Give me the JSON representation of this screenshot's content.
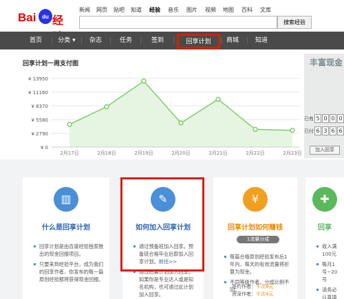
{
  "header": {
    "logo_text": "Bai",
    "logo_paw": "du",
    "logo_suffix": "经验",
    "nav_links": [
      "新闻",
      "网页",
      "贴吧",
      "知道",
      "经验",
      "音乐",
      "图片",
      "视频",
      "地图",
      "百科",
      "文库"
    ],
    "active_link": "经验",
    "search_value": "",
    "search_button": "搜索经验"
  },
  "main_nav": {
    "items": [
      "首页",
      "分类",
      "杂志",
      "任务",
      "签到",
      "回享计划",
      "商城",
      "知道"
    ],
    "dropdown_marker": "▾",
    "highlighted": "回享计划"
  },
  "chart_section": {
    "title": "回享计划一周支付图"
  },
  "chart_data": {
    "type": "area",
    "title": "回享计划一周支付图",
    "categories": [
      "2月17日",
      "2月18日",
      "2月19日",
      "2月20日",
      "2月21日",
      "2月22日",
      "2月23日"
    ],
    "series": [
      {
        "values": [
          4600,
          8200,
          13400,
          4900,
          9700,
          3600,
          3400
        ]
      }
    ],
    "yticks": [
      "¥ 13950",
      "¥ 11160",
      "¥ 8370",
      "¥ 5580",
      "¥ 2790",
      "¥ 0"
    ],
    "ytick_values": [
      13950,
      11160,
      8370,
      5580,
      2790,
      0
    ],
    "ylim": [
      0,
      13950
    ],
    "grid": true,
    "colors": {
      "line": "#7bcf6a",
      "fill": "#e6f5e1"
    }
  },
  "promo": {
    "headline": "丰富现金",
    "row1_label": "已有",
    "row1_digits": [
      "5",
      "0",
      "0",
      "0"
    ],
    "row2_label": "已付",
    "row2_digits": [
      "6",
      "3",
      "6",
      "6"
    ],
    "join_button": "加入回享"
  },
  "cards": [
    {
      "title": "什么是回享计划",
      "icon": "book-icon",
      "icon_color": "#4a8fd8",
      "title_color": "#2d64b3",
      "paragraphs": [
        "回享计划是由百度经验独家推出的现金回报项目。",
        "只要来到经验平台，成为我们的回享作者，你发布的每一篇原创经验都将获得现金回报。"
      ]
    },
    {
      "title": "如何加入回享计划",
      "icon": "edit-icon",
      "icon_color": "#4a8fd8",
      "title_color": "#2d64b3",
      "paragraphs": [
        "通过预备班加入回享。预备班合格毕业后即加入回享计划。",
        "通过招募计划加入回享。如果你是专业达人或是知名机构，也可通过此计划加入回享。"
      ],
      "more_link": "前往>>"
    },
    {
      "title": "回享计划如何赚钱",
      "icon": "money-icon",
      "icon_color": "#f0a020",
      "title_color": "#e88a00",
      "pill": "1流量分成",
      "paragraphs": [
        "每篇合格原创经验发布后1年内，每天的有效流量将折算为现金。",
        "不同等级作者，分成比例不同。"
      ],
      "rows": [
        {
          "label": "签约作者：",
          "value": "千次8元"
        },
        {
          "label": "资深作者：",
          "value": "千次4元"
        }
      ]
    },
    {
      "title": "回享",
      "icon": "gift-icon",
      "icon_color": "#5cb85c",
      "title_color": "#5cb85c",
      "paragraphs": [
        "收入满100元",
        "每月1号~20号",
        "请务必认真填写"
      ]
    }
  ]
}
